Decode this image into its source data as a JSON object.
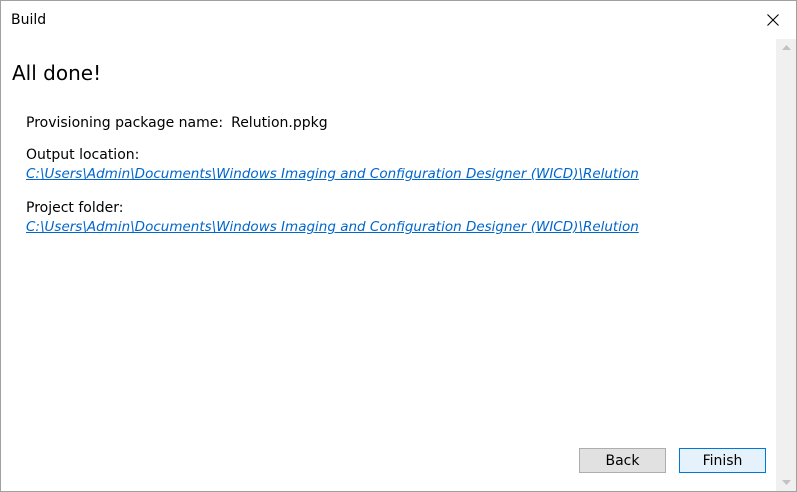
{
  "window": {
    "title": "Build"
  },
  "main": {
    "heading": "All done!",
    "package_name_label": "Provisioning package name:",
    "package_name_value": "Relution.ppkg",
    "output_location_label": "Output location:",
    "output_location_path": "C:\\Users\\Admin\\Documents\\Windows Imaging and Configuration Designer (WICD)\\Relution",
    "project_folder_label": "Project folder:",
    "project_folder_path": "C:\\Users\\Admin\\Documents\\Windows Imaging and Configuration Designer (WICD)\\Relution"
  },
  "buttons": {
    "back_label": "Back",
    "finish_label": "Finish"
  },
  "icons": {
    "close": "close-icon",
    "scroll_up": "scroll-up-arrow-icon",
    "scroll_down": "scroll-down-arrow-icon"
  },
  "colors": {
    "link": "#0066cc",
    "finish_border": "#0078d7",
    "finish_fill": "#e5f1fb",
    "back_fill": "#e1e1e1"
  }
}
